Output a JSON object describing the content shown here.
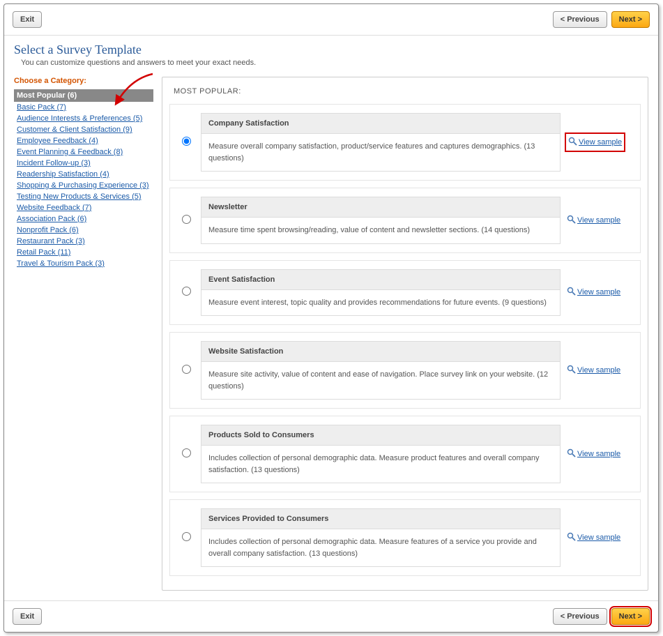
{
  "buttons": {
    "exit": "Exit",
    "prev": "< Previous",
    "next": "Next >"
  },
  "header": {
    "title": "Select a Survey Template",
    "subtitle": "You can customize questions and answers to meet your exact needs."
  },
  "sidebar": {
    "heading": "Choose a Category:",
    "active": "Most Popular (6)",
    "items": [
      "Basic Pack (7)",
      "Audience Interests & Preferences (5)",
      "Customer & Client Satisfaction (9)",
      "Employee Feedback (4)",
      "Event Planning & Feedback (8)",
      "Incident Follow-up (3)",
      "Readership Satisfaction (4)",
      "Shopping & Purchasing Experience (3)",
      "Testing New Products & Services (5)",
      "Website Feedback (7)",
      "Association Pack (6)",
      "Nonprofit Pack (6)",
      "Restaurant Pack (3)",
      "Retail Pack (11)",
      "Travel & Tourism Pack (3)"
    ]
  },
  "panel": {
    "heading": "MOST POPULAR:",
    "view_label": "View sample",
    "templates": [
      {
        "title": "Company Satisfaction",
        "desc": "Measure overall company satisfaction, product/service features and captures demographics. (13 questions)",
        "selected": true,
        "highlight": true
      },
      {
        "title": "Newsletter",
        "desc": "Measure time spent browsing/reading, value of content and newsletter sections. (14 questions)",
        "selected": false,
        "highlight": false
      },
      {
        "title": "Event Satisfaction",
        "desc": "Measure event interest, topic quality and provides recommendations for future events. (9 questions)",
        "selected": false,
        "highlight": false
      },
      {
        "title": "Website Satisfaction",
        "desc": "Measure site activity, value of content and ease of navigation. Place survey link on your website. (12 questions)",
        "selected": false,
        "highlight": false
      },
      {
        "title": "Products Sold to Consumers",
        "desc": "Includes collection of personal demographic data. Measure product features and overall company satisfaction. (13 questions)",
        "selected": false,
        "highlight": false
      },
      {
        "title": "Services Provided to Consumers",
        "desc": "Includes collection of personal demographic data. Measure features of a service you provide and overall company satisfaction. (13 questions)",
        "selected": false,
        "highlight": false
      }
    ]
  }
}
